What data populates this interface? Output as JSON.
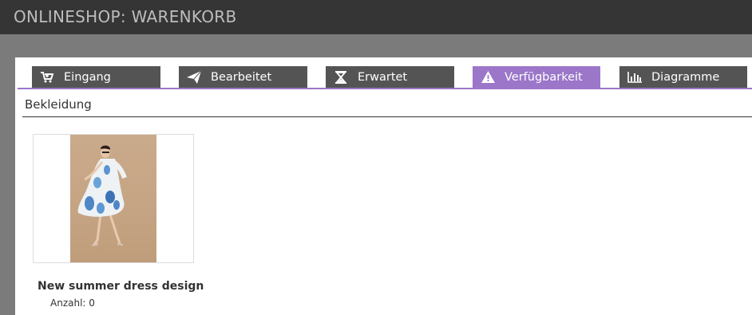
{
  "app": {
    "title": "ONLINESHOP: WARENKORB"
  },
  "tabs": [
    {
      "label": "Eingang",
      "icon": "cart-icon",
      "active": false
    },
    {
      "label": "Bearbeitet",
      "icon": "paper-plane-icon",
      "active": false
    },
    {
      "label": "Erwartet",
      "icon": "hourglass-icon",
      "active": false
    },
    {
      "label": "Verfügbarkeit",
      "icon": "warning-icon",
      "active": true
    },
    {
      "label": "Diagramme",
      "icon": "bar-chart-icon",
      "active": false
    }
  ],
  "section": {
    "title": "Bekleidung"
  },
  "products": [
    {
      "name": "New summer dress design",
      "quantity": "Anzahl: 0"
    }
  ],
  "colors": {
    "topbar": "#353535",
    "tab": "#545454",
    "active_tab": "#9b76c9",
    "page_background": "#7b7b7b"
  }
}
